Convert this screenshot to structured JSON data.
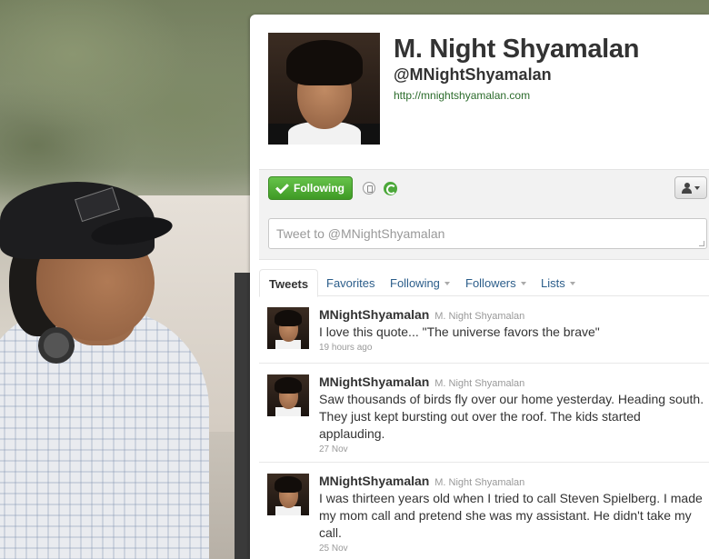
{
  "profile": {
    "full_name": "M. Night Shyamalan",
    "screen_name": "@MNightShyamalan",
    "url": "http://mnightshyamalan.com"
  },
  "actions": {
    "follow_label": "Following",
    "tweet_placeholder": "Tweet to @MNightShyamalan"
  },
  "tabs": [
    {
      "label": "Tweets",
      "active": true
    },
    {
      "label": "Favorites"
    },
    {
      "label": "Following",
      "dropdown": true
    },
    {
      "label": "Followers",
      "dropdown": true
    },
    {
      "label": "Lists",
      "dropdown": true
    }
  ],
  "tweets": [
    {
      "username": "MNightShyamalan",
      "realname": "M. Night Shyamalan",
      "text": "I love this quote... \"The universe favors the brave\"",
      "time": "19 hours ago"
    },
    {
      "username": "MNightShyamalan",
      "realname": "M. Night Shyamalan",
      "text": "Saw thousands of birds fly over our home yesterday. Heading south. They just kept bursting out over the roof. The kids started applauding.",
      "time": "27 Nov"
    },
    {
      "username": "MNightShyamalan",
      "realname": "M. Night Shyamalan",
      "text": "I was thirteen years old when I tried to call Steven Spielberg. I made my mom call and pretend she was my assistant. He didn't take my call.",
      "time": "25 Nov"
    }
  ],
  "colors": {
    "follow_green": "#4fae32",
    "link_blue": "#2b5d8a",
    "url_green": "#2b6b2b"
  }
}
